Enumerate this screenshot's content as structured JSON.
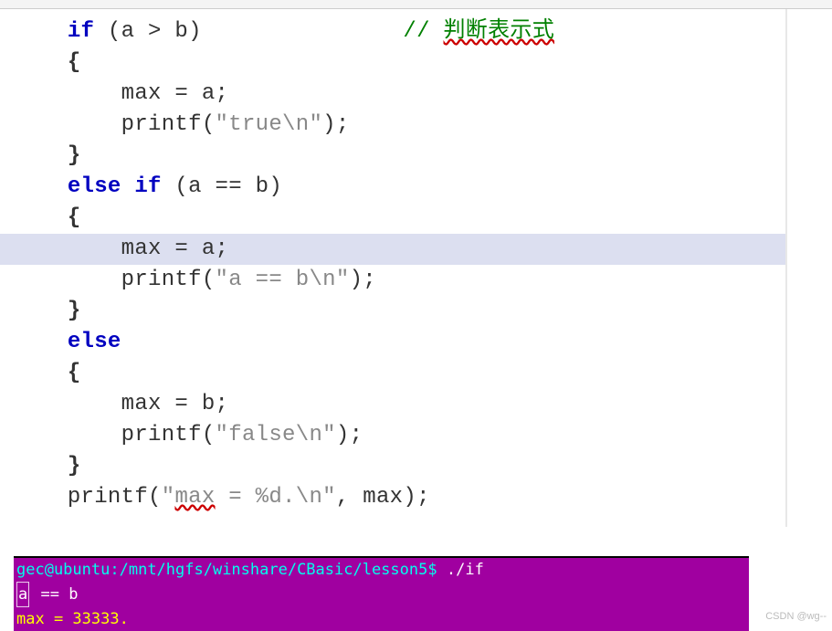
{
  "code": {
    "lines": [
      {
        "indent": "    ",
        "content": [
          {
            "t": "kw",
            "v": "if"
          },
          {
            "t": "txt",
            "v": " (a > b)"
          },
          {
            "t": "spacer",
            "v": "               "
          },
          {
            "t": "comment-slash",
            "v": "// "
          },
          {
            "t": "comment-text",
            "v": "判断表示式"
          }
        ]
      },
      {
        "indent": "    ",
        "content": [
          {
            "t": "punct",
            "v": "{"
          }
        ]
      },
      {
        "indent": "        ",
        "content": [
          {
            "t": "txt",
            "v": "max = a;"
          }
        ]
      },
      {
        "indent": "        ",
        "content": [
          {
            "t": "txt",
            "v": "printf("
          },
          {
            "t": "str",
            "v": "\"true\\n\""
          },
          {
            "t": "txt",
            "v": ");"
          }
        ]
      },
      {
        "indent": "    ",
        "content": [
          {
            "t": "punct",
            "v": "}"
          }
        ]
      },
      {
        "indent": "    ",
        "content": [
          {
            "t": "kw",
            "v": "else"
          },
          {
            "t": "txt",
            "v": " "
          },
          {
            "t": "kw",
            "v": "if"
          },
          {
            "t": "txt",
            "v": " (a == b)"
          }
        ]
      },
      {
        "indent": "    ",
        "content": [
          {
            "t": "punct",
            "v": "{"
          }
        ]
      },
      {
        "indent": "        ",
        "highlight": true,
        "content": [
          {
            "t": "txt",
            "v": "max = a;"
          }
        ]
      },
      {
        "indent": "        ",
        "content": [
          {
            "t": "txt",
            "v": "printf("
          },
          {
            "t": "str",
            "v": "\"a == b\\n\""
          },
          {
            "t": "txt",
            "v": ");"
          }
        ]
      },
      {
        "indent": "    ",
        "content": [
          {
            "t": "punct",
            "v": "}"
          }
        ]
      },
      {
        "indent": "    ",
        "content": [
          {
            "t": "kw",
            "v": "else"
          }
        ]
      },
      {
        "indent": "    ",
        "content": [
          {
            "t": "punct",
            "v": "{"
          }
        ]
      },
      {
        "indent": "        ",
        "content": [
          {
            "t": "txt",
            "v": "max = b;"
          }
        ]
      },
      {
        "indent": "        ",
        "content": [
          {
            "t": "txt",
            "v": "printf("
          },
          {
            "t": "str",
            "v": "\"false\\n\""
          },
          {
            "t": "txt",
            "v": ");"
          }
        ]
      },
      {
        "indent": "    ",
        "content": [
          {
            "t": "punct",
            "v": "}"
          }
        ]
      },
      {
        "indent": "    ",
        "content": [
          {
            "t": "txt",
            "v": "printf("
          },
          {
            "t": "str-open",
            "v": "\""
          },
          {
            "t": "warn-underline-str",
            "v": "max"
          },
          {
            "t": "str",
            "v": " = %d.\\n\""
          },
          {
            "t": "txt",
            "v": ", max);"
          }
        ]
      }
    ]
  },
  "terminal": {
    "prompt_user_host": "gec@ubuntu",
    "prompt_sep": ":",
    "prompt_path": "/mnt/hgfs/winshare/CBasic/lesson5",
    "prompt_end": "$ ",
    "command": "./if",
    "line2_prefix": "a",
    "line2_text": " == b",
    "line3": "max = 33333."
  },
  "watermark": "CSDN @wg--"
}
